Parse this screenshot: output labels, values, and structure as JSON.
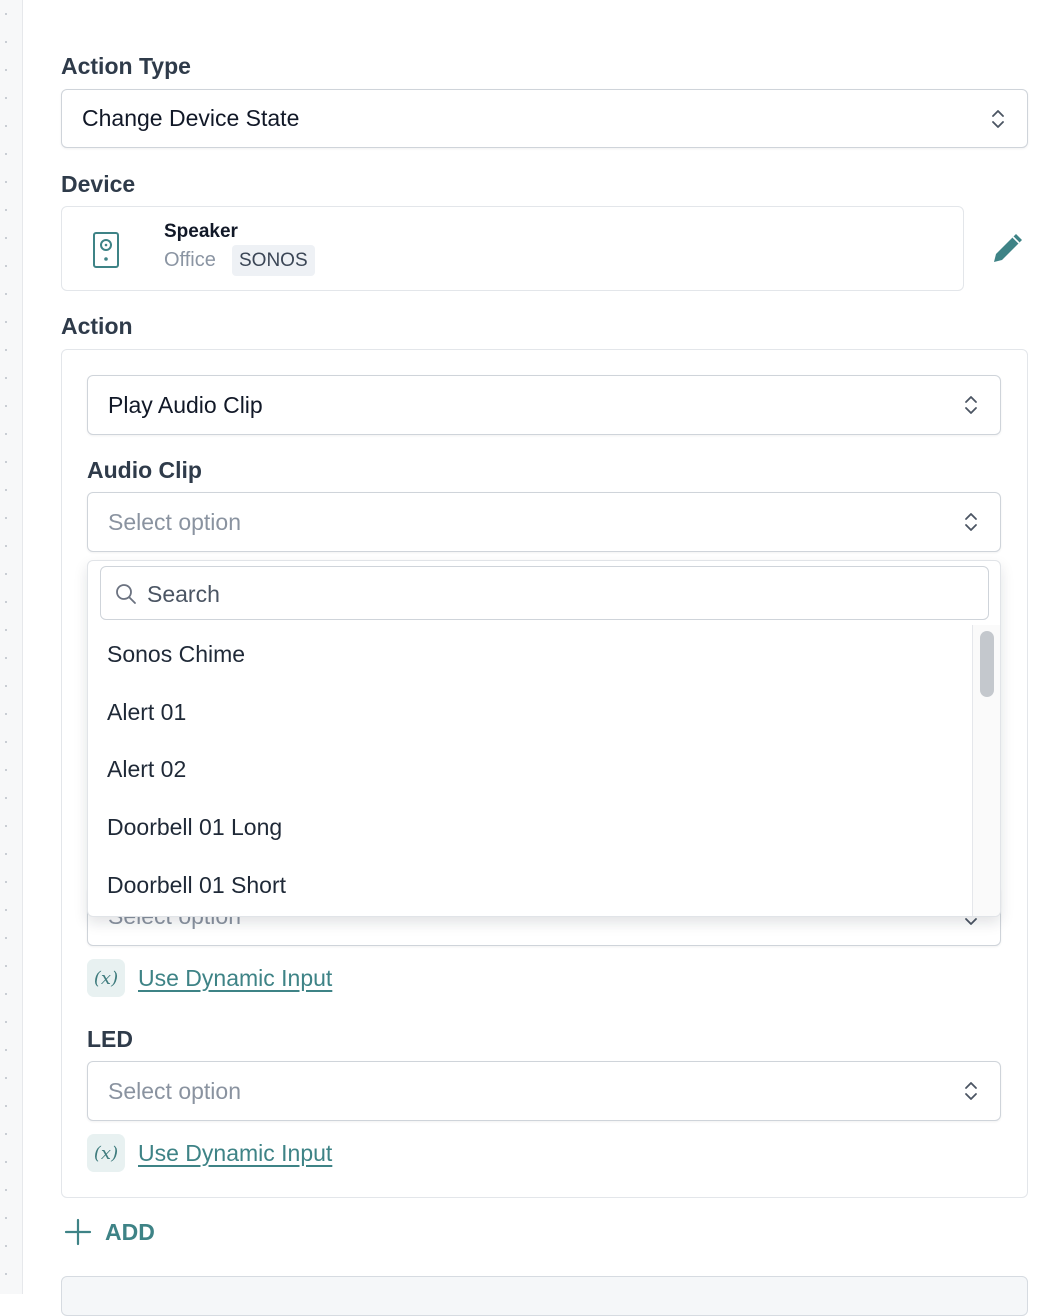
{
  "action_type": {
    "label": "Action Type",
    "value": "Change Device State"
  },
  "device": {
    "label": "Device",
    "name": "Speaker",
    "location": "Office",
    "brand": "SONOS"
  },
  "action": {
    "label": "Action",
    "value": "Play Audio Clip",
    "audio_clip": {
      "label": "Audio Clip",
      "placeholder": "Select option"
    },
    "hidden_select": {
      "placeholder": "Select option"
    },
    "dynamic_input_1": "Use Dynamic Input",
    "led": {
      "label": "LED",
      "placeholder": "Select option"
    },
    "dynamic_input_2": "Use Dynamic Input",
    "dynamic_badge": "(x)"
  },
  "dropdown": {
    "search_placeholder": "Search",
    "options": [
      "Sonos Chime",
      "Alert 01",
      "Alert 02",
      "Doorbell 01 Long",
      "Doorbell 01 Short"
    ]
  },
  "add_label": "ADD",
  "colors": {
    "accent": "#3e8386",
    "border": "#cfd4da",
    "label": "#2f3b4a"
  }
}
